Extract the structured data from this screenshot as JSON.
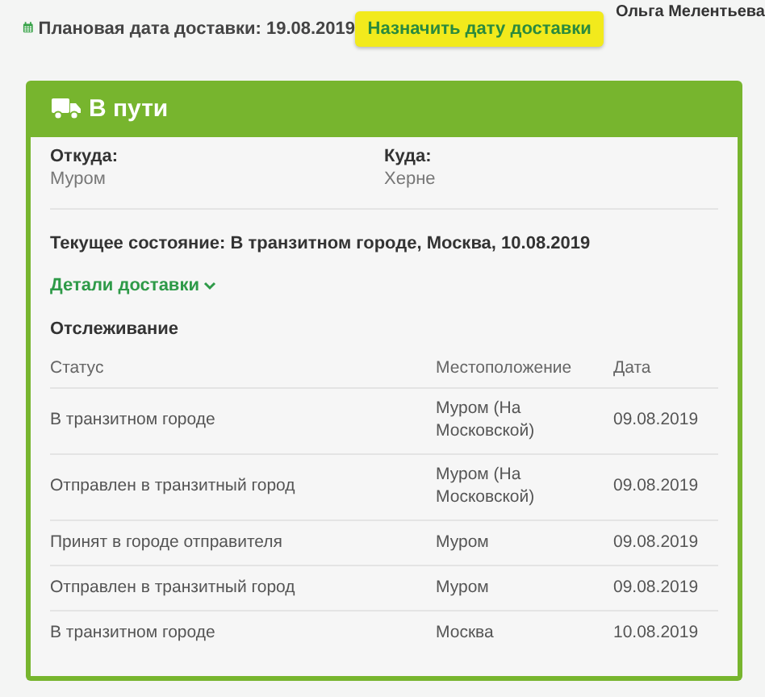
{
  "header": {
    "planned_date": "Плановая дата доставки: 19.08.2019",
    "assign_button": "Назначить дату доставки",
    "user_name": "Ольга Мелентьева"
  },
  "card": {
    "title": "В пути",
    "from": {
      "label": "Откуда:",
      "value": "Муром"
    },
    "to": {
      "label": "Куда:",
      "value": "Херне"
    },
    "current_state": "Текущее состояние: В транзитном городе, Москва, 10.08.2019",
    "details_link": {
      "label": "Детали доставки",
      "expanded": false
    },
    "tracking": {
      "title": "Отслеживание",
      "columns": [
        "Статус",
        "Местоположение",
        "Дата"
      ],
      "rows": [
        {
          "status": "В транзитном городе",
          "location": "Муром (На Московской)",
          "date": "09.08.2019"
        },
        {
          "status": "Отправлен в транзитный город",
          "location": "Муром (На Московской)",
          "date": "09.08.2019"
        },
        {
          "status": "Принят в городе отправителя",
          "location": "Муром",
          "date": "09.08.2019"
        },
        {
          "status": "Отправлен в транзитный город",
          "location": "Муром",
          "date": "09.08.2019"
        },
        {
          "status": "В транзитном городе",
          "location": "Москва",
          "date": "10.08.2019"
        }
      ]
    }
  }
}
